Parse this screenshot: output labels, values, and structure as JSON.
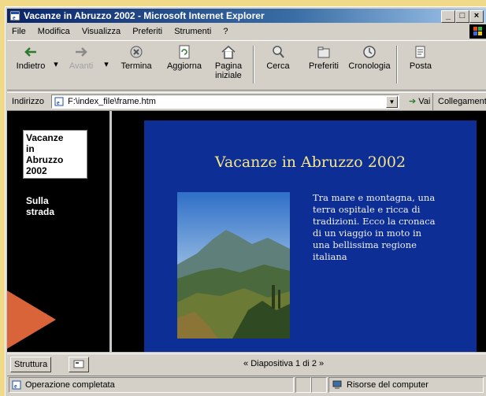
{
  "window": {
    "title": "Vacanze in Abruzzo 2002 - Microsoft Internet Explorer"
  },
  "titlebar_buttons": {
    "minimize": "_",
    "maximize": "□",
    "close": "×"
  },
  "menu": [
    "File",
    "Modifica",
    "Visualizza",
    "Preferiti",
    "Strumenti",
    "?"
  ],
  "toolbar": {
    "back": "Indietro",
    "forward": "Avanti",
    "stop": "Termina",
    "refresh": "Aggiorna",
    "home": "Pagina iniziale",
    "search": "Cerca",
    "favorites": "Preferiti",
    "history": "Cronologia",
    "mail": "Posta"
  },
  "address": {
    "label": "Indirizzo",
    "value": "F:\\index_file\\frame.htm",
    "go_label": "Vai",
    "links_label": "Collegamenti"
  },
  "outline": {
    "title_lines": [
      "Vacanze",
      "in",
      "Abruzzo",
      "2002"
    ],
    "subtitle": "Sulla strada"
  },
  "slide": {
    "title": "Vacanze in Abruzzo 2002",
    "body": "Tra mare e montagna, una terra ospitale e ricca di tradizioni. Ecco la cronaca di un viaggio in moto in una bellissima regione italiana"
  },
  "bottom": {
    "outline_button": "Struttura",
    "slide_counter": "Diapositiva 1 di 2"
  },
  "status": {
    "text": "Operazione completata",
    "zone": "Risorse del computer"
  },
  "colors": {
    "slide_bg": "#0d2f95",
    "slide_title": "#f6e68a",
    "page_bg": "#f1d98a",
    "arrow": "#d9643a"
  }
}
